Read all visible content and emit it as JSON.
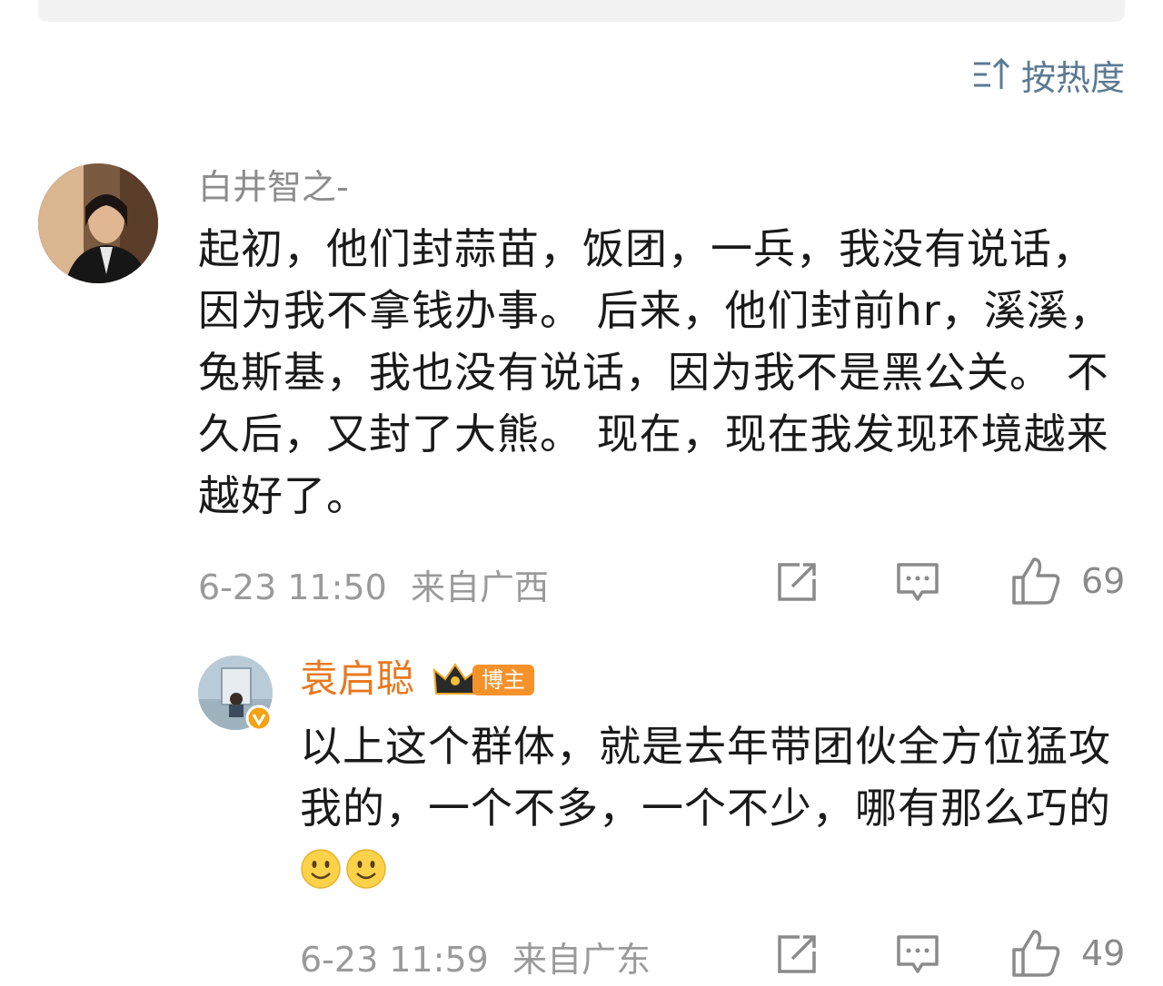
{
  "sort": {
    "label": "按热度",
    "icon": "sort-icon"
  },
  "comments": [
    {
      "username": "白井智之-",
      "text": "起初，他们封蒜苗，饭团，一兵，我没有说话，因为我不拿钱办事。 后来，他们封前hr，溪溪，兔斯基，我也没有说话，因为我不是黑公关。 不久后，又封了大熊。 现在，现在我发现环境越来越好了。",
      "time": "6-23 11:50",
      "location": "来自广西",
      "likes": "69"
    }
  ],
  "reply": {
    "username": "袁启聪",
    "badge": "博主",
    "text": "以上这个群体，就是去年带团伙全方位猛攻我的，一个不多，一个不少，哪有那么巧的",
    "emoji_count": 2,
    "emoji": "smile-emoji",
    "time": "6-23 11:59",
    "location": "来自广东",
    "likes": "49"
  },
  "colors": {
    "sort": "#5b7a94",
    "username": "#8c8c8c",
    "reply_username": "#e8781f",
    "meta": "#9a9a9a",
    "icon": "#8a8a8a"
  }
}
